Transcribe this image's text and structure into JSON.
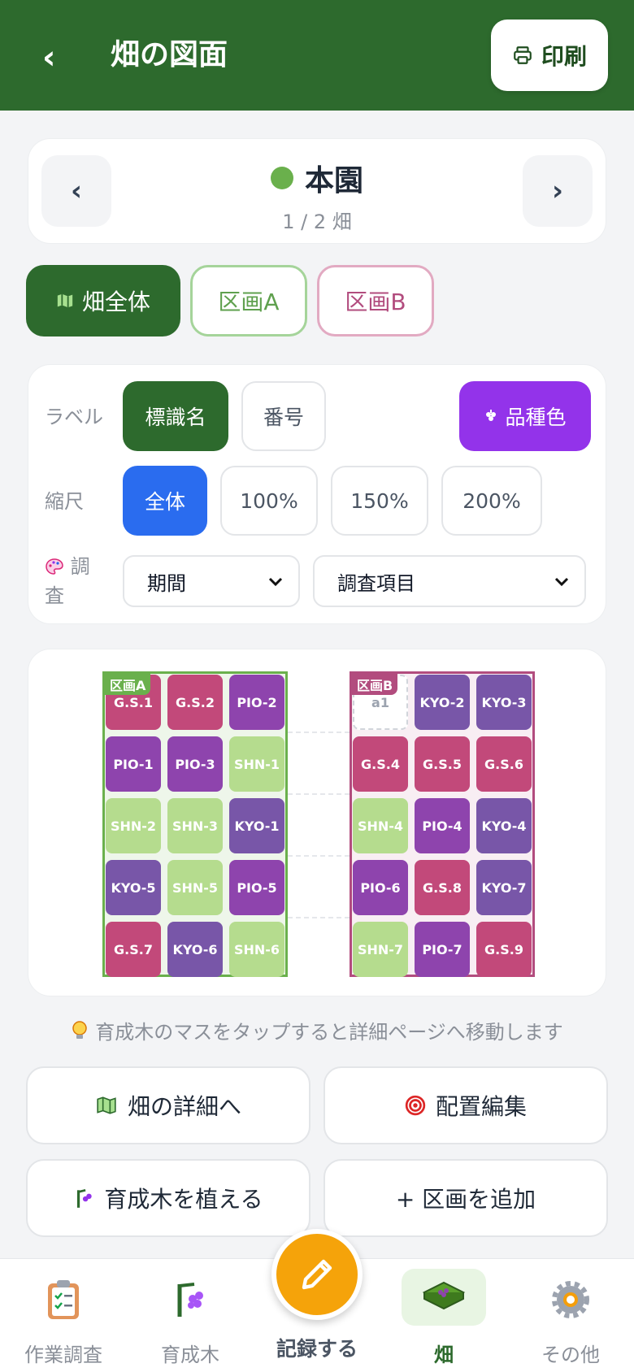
{
  "header": {
    "back": "‹",
    "title": "畑の図面",
    "print_label": "印刷"
  },
  "farm": {
    "prev": "‹",
    "next": "›",
    "name": "本園",
    "count": "1 / 2 畑",
    "dot_color": "#6ab04c"
  },
  "tabs": [
    {
      "label": "畑全体"
    },
    {
      "label": "区画A"
    },
    {
      "label": "区画B"
    }
  ],
  "controls": {
    "label_row": {
      "label": "ラベル",
      "options": [
        "標識名",
        "番号"
      ],
      "variety_color": "品種色"
    },
    "scale_row": {
      "label": "縮尺",
      "options": [
        "全体",
        "100%",
        "150%",
        "200%"
      ]
    },
    "survey_row": {
      "label_line1": "調",
      "label_line2": "査",
      "period": "期間",
      "item": "調査項目"
    }
  },
  "map": {
    "section_a": {
      "label": "区画A",
      "cells": [
        [
          "G.S.1",
          "G.S.2",
          "PIO-2"
        ],
        [
          "PIO-1",
          "PIO-3",
          "SHN-1"
        ],
        [
          "SHN-2",
          "SHN-3",
          "KYO-1"
        ],
        [
          "KYO-5",
          "SHN-5",
          "PIO-5"
        ],
        [
          "G.S.7",
          "KYO-6",
          "SHN-6"
        ]
      ]
    },
    "section_b": {
      "label": "区画B",
      "cells": [
        [
          "a1",
          "KYO-2",
          "KYO-3"
        ],
        [
          "G.S.4",
          "G.S.5",
          "G.S.6"
        ],
        [
          "SHN-4",
          "PIO-4",
          "KYO-4"
        ],
        [
          "PIO-6",
          "G.S.8",
          "KYO-7"
        ],
        [
          "SHN-7",
          "PIO-7",
          "G.S.9"
        ]
      ]
    },
    "variety_colors": {
      "G.S.": "#c2497a",
      "PIO": "#8e44ad",
      "SHN": "#b5dc8e",
      "KYO": "#7856a8"
    }
  },
  "hint": "育成木のマスをタップすると詳細ページへ移動します",
  "actions": {
    "details": "畑の詳細へ",
    "edit_layout": "配置編集",
    "plant": "育成木を植える",
    "add_section": "+ 区画を追加"
  },
  "bottom_nav": {
    "work_survey": "作業調査",
    "seedlings": "育成木",
    "record": "記録する",
    "field": "畑",
    "other": "その他"
  }
}
